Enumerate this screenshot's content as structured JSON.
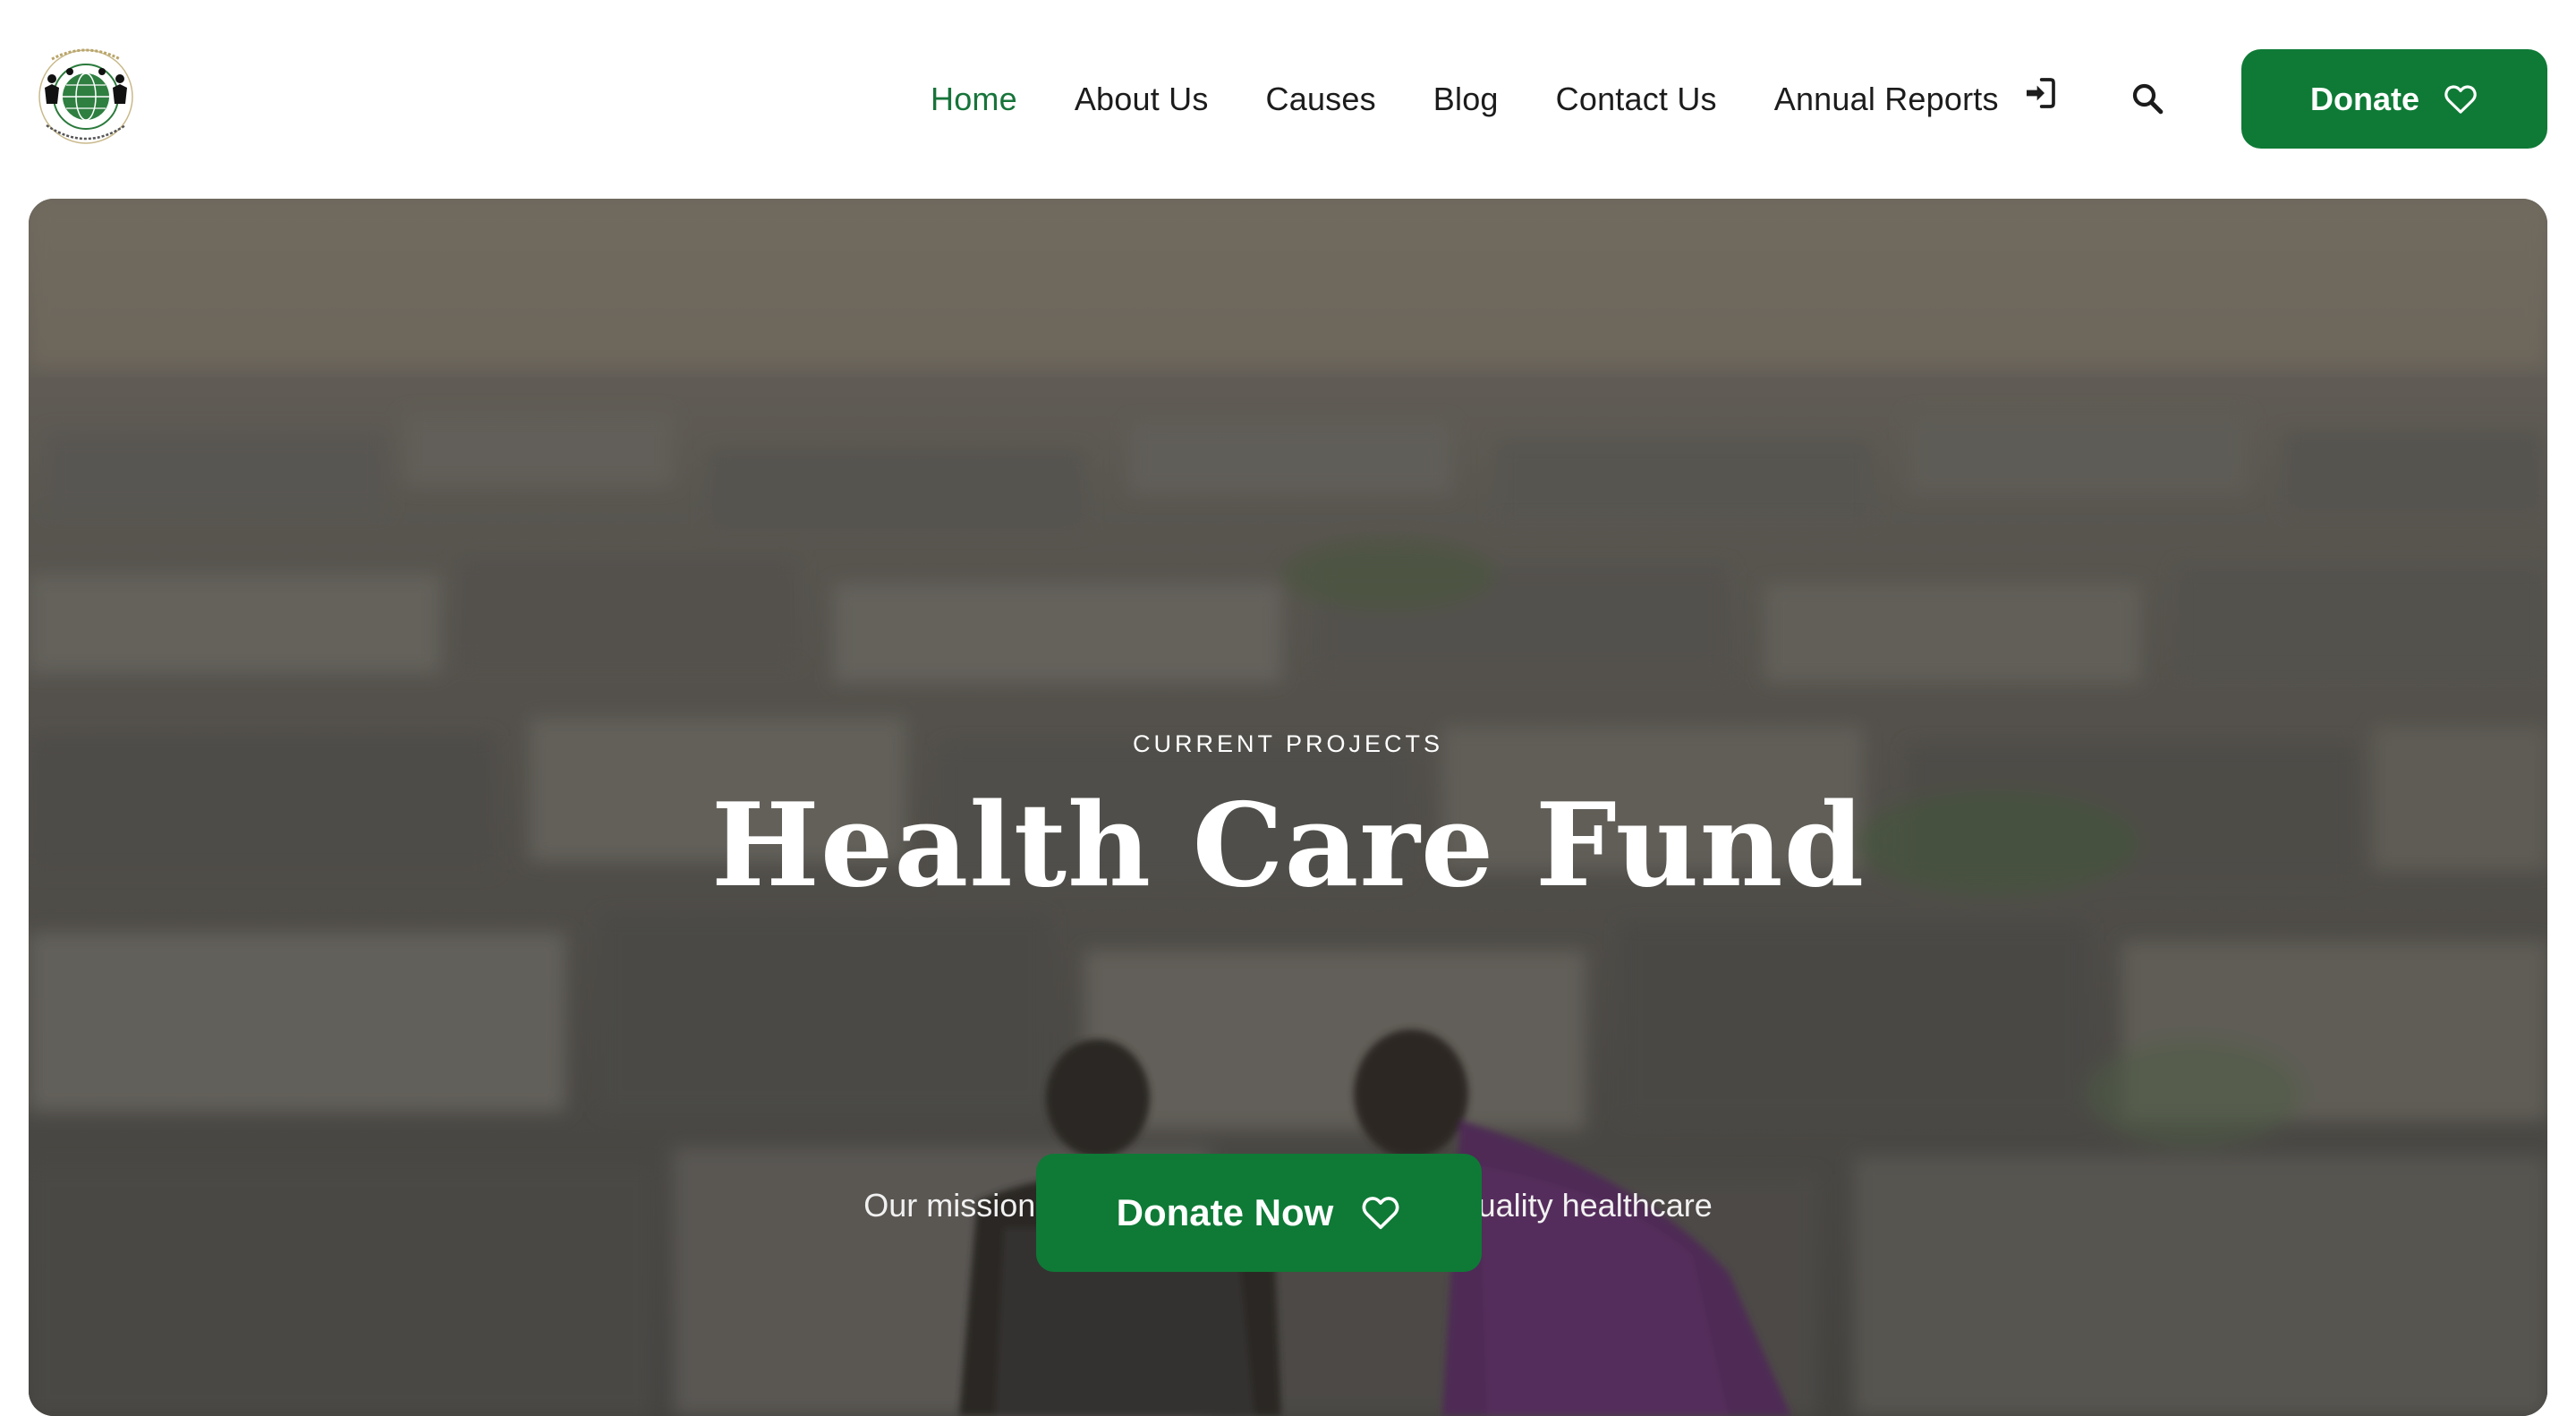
{
  "brand": {
    "logo_icon": "charity-globe-logo",
    "logo_text_top": "OLUBAKESI",
    "logo_text_bottom": "CHARITY FOUNDATION"
  },
  "nav": {
    "items": [
      {
        "label": "Home",
        "active": true
      },
      {
        "label": "About Us",
        "active": false
      },
      {
        "label": "Causes",
        "active": false
      },
      {
        "label": "Blog",
        "active": false
      },
      {
        "label": "Contact Us",
        "active": false
      },
      {
        "label": "Annual Reports",
        "active": false
      }
    ],
    "login_icon": "login-arrow-icon",
    "search_icon": "search-icon"
  },
  "header": {
    "donate_label": "Donate",
    "donate_icon": "heart-outline-icon"
  },
  "hero": {
    "eyebrow": "CURRENT PROJECTS",
    "title": "Health Care Fund",
    "subtitle": "Our mission is to provide accessable and quality healthcare",
    "cta_label": "Donate Now",
    "cta_icon": "heart-outline-icon"
  },
  "colors": {
    "brand_green": "#0e7a36",
    "nav_active": "#17743a",
    "nav_text": "#1c1c1c"
  }
}
